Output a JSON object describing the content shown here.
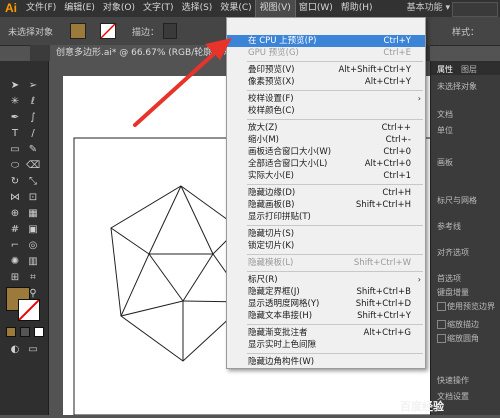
{
  "app": {
    "logo": "Ai"
  },
  "menubar": {
    "items": [
      "文件(F)",
      "编辑(E)",
      "对象(O)",
      "文字(T)",
      "选择(S)",
      "效果(C)",
      "视图(V)",
      "窗口(W)",
      "帮助(H)"
    ],
    "workspace": "基本功能",
    "workspace_arrow": "▾"
  },
  "control": {
    "selection_label": "未选择对象",
    "stroke_label": "描边：",
    "style_label": "样式：",
    "fill_color": "#9b7a3c"
  },
  "document": {
    "tab": "创意多边形.ai* @ 66.67% (RGB/轮廓)",
    "close": "×"
  },
  "panel": {
    "tab": "属性",
    "tab2": "图层",
    "texts": [
      "未选择对象",
      "文档",
      "单位",
      "画板",
      "标尺与网格",
      "参考线",
      "对齐选项",
      "首选项",
      "键盘增量",
      "使用预览边界",
      "缩放描边",
      "缩放圆角",
      "快速操作",
      "文档设置"
    ]
  },
  "view_menu": {
    "items": [
      {
        "label": "在 CPU 上预览(P)",
        "shortcut": "Ctrl+Y",
        "highlight": true
      },
      {
        "label": "GPU 预览(G)",
        "shortcut": "Ctrl+E",
        "disabled": true
      },
      {
        "sep": true
      },
      {
        "label": "叠印预览(V)",
        "shortcut": "Alt+Shift+Ctrl+Y"
      },
      {
        "label": "像素预览(X)",
        "shortcut": "Alt+Ctrl+Y"
      },
      {
        "sep": true
      },
      {
        "label": "校样设置(F)",
        "shortcut": "",
        "submenu": true
      },
      {
        "label": "校样颜色(C)",
        "shortcut": ""
      },
      {
        "sep": true
      },
      {
        "label": "放大(Z)",
        "shortcut": "Ctrl++"
      },
      {
        "label": "缩小(M)",
        "shortcut": "Ctrl+-"
      },
      {
        "label": "画板适合窗口大小(W)",
        "shortcut": "Ctrl+0"
      },
      {
        "label": "全部适合窗口大小(L)",
        "shortcut": "Alt+Ctrl+0"
      },
      {
        "label": "实际大小(E)",
        "shortcut": "Ctrl+1"
      },
      {
        "sep": true
      },
      {
        "label": "隐藏边缘(D)",
        "shortcut": "Ctrl+H"
      },
      {
        "label": "隐藏画板(B)",
        "shortcut": "Shift+Ctrl+H"
      },
      {
        "label": "显示打印拼贴(T)",
        "shortcut": ""
      },
      {
        "sep": true
      },
      {
        "label": "隐藏切片(S)",
        "shortcut": ""
      },
      {
        "label": "锁定切片(K)",
        "shortcut": ""
      },
      {
        "sep": true
      },
      {
        "label": "隐藏模板(L)",
        "shortcut": "Shift+Ctrl+W",
        "disabled": true
      },
      {
        "sep": true
      },
      {
        "label": "标尺(R)",
        "shortcut": "",
        "submenu": true
      },
      {
        "label": "隐藏定界框(J)",
        "shortcut": "Shift+Ctrl+B"
      },
      {
        "label": "显示透明度网格(Y)",
        "shortcut": "Shift+Ctrl+D"
      },
      {
        "label": "隐藏文本串接(H)",
        "shortcut": "Shift+Ctrl+Y"
      },
      {
        "sep": true
      },
      {
        "label": "隐藏渐变批注者",
        "shortcut": "Alt+Ctrl+G"
      },
      {
        "label": "显示实时上色间隙",
        "shortcut": ""
      },
      {
        "sep": true
      },
      {
        "label": "隐藏边角构件(W)",
        "shortcut": ""
      }
    ]
  },
  "watermark": "百度经验",
  "arrow_color": "#e8332a"
}
